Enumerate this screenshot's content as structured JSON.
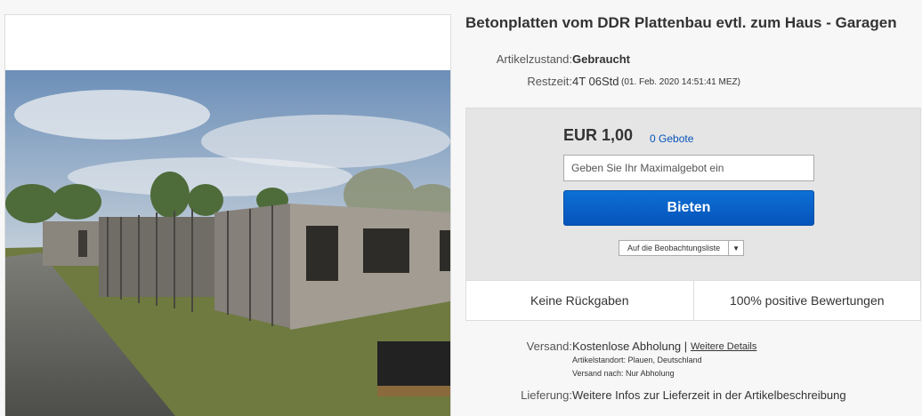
{
  "listing": {
    "title": "Betonplatten vom DDR Plattenbau evtl. zum Haus - Garagen",
    "condition_label": "Artikelzustand:",
    "condition_value": "Gebraucht",
    "time_label": "Restzeit:",
    "time_left": "4T 06Std",
    "time_end": "(01. Feb. 2020   14:51:41 MEZ)"
  },
  "bid": {
    "price": "EUR 1,00",
    "bid_count": "0 Gebote",
    "max_bid_placeholder": "Geben Sie Ihr Maximalgebot ein",
    "bid_button": "Bieten",
    "watchlist": "Auf die Beobachtungsliste"
  },
  "promises": {
    "returns": "Keine Rückgaben",
    "rating": "100% positive Bewertungen"
  },
  "shipping": {
    "label": "Versand:",
    "value": "Kostenlose Abholung |",
    "details_link": "Weitere Details",
    "location": "Artikelstandort:  Plauen, Deutschland",
    "ship_to": "Versand nach:  Nur Abholung"
  },
  "delivery": {
    "label": "Lieferung:",
    "value": "Weitere Infos zur Lieferzeit in der Artikelbeschreibung"
  },
  "colors": {
    "accent": "#0654ba",
    "bid_box": "#e5e5e5"
  }
}
